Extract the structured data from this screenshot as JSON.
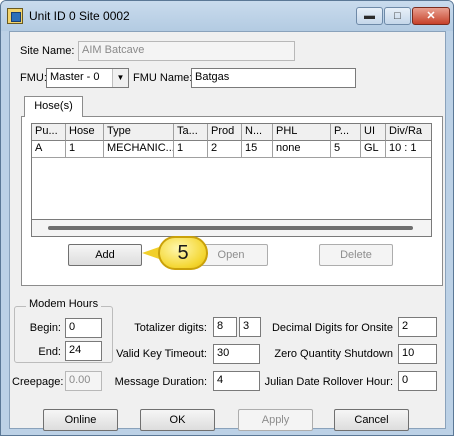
{
  "window": {
    "title": "Unit ID 0 Site 0002",
    "minimize_glyph": "▬",
    "maximize_glyph": "□",
    "close_glyph": "✕"
  },
  "site": {
    "label": "Site Name:",
    "value": "AIM Batcave"
  },
  "fmu": {
    "label": "FMU:",
    "selected": "Master - 0",
    "name_label": "FMU Name:",
    "name_value": "Batgas"
  },
  "tabs": [
    {
      "label": "Hose(s)",
      "active": true
    }
  ],
  "hoses_table": {
    "columns": [
      "Pu...",
      "Hose",
      "Type",
      "Ta...",
      "Prod",
      "N...",
      "PHL",
      "P...",
      "UI",
      "Div/Ra"
    ],
    "rows": [
      [
        "A",
        "1",
        "MECHANIC...",
        "1",
        "2",
        "15",
        "none",
        "5",
        "GL",
        "10 : 1"
      ]
    ]
  },
  "hose_buttons": {
    "add": "Add",
    "open": "Open",
    "delete": "Delete"
  },
  "callout": {
    "number": "5",
    "color": "#f4d630"
  },
  "modem_hours": {
    "title": "Modem Hours",
    "begin_label": "Begin:",
    "begin_value": "0",
    "end_label": "End:",
    "end_value": "24"
  },
  "creepage": {
    "label": "Creepage:",
    "value": "0.00"
  },
  "totalizer_digits": {
    "label": "Totalizer digits:",
    "value1": "8",
    "value2": "3"
  },
  "valid_key_timeout": {
    "label": "Valid Key Timeout:",
    "value": "30"
  },
  "message_duration": {
    "label": "Message Duration:",
    "value": "4"
  },
  "decimal_digits": {
    "label": "Decimal Digits for Onsite",
    "value": "2"
  },
  "zero_quantity_shutdown": {
    "label": "Zero Quantity Shutdown",
    "value": "10"
  },
  "julian_rollover": {
    "label": "Julian Date Rollover Hour:",
    "value": "0"
  },
  "footer_buttons": {
    "online": "Online",
    "ok": "OK",
    "apply": "Apply",
    "cancel": "Cancel"
  },
  "colors": {
    "window_frame": "#bcd1e6",
    "client_bg": "#f0f0f0",
    "close_button": "#c7412a"
  }
}
